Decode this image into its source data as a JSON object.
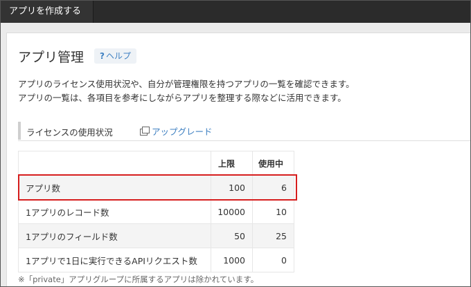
{
  "topbar": {
    "tab_label": "アプリを作成する"
  },
  "page": {
    "title": "アプリ管理",
    "help_label": "ヘルプ",
    "description_line1": "アプリのライセンス使用状況や、自分が管理権限を持つアプリの一覧を確認できます。",
    "description_line2": "アプリの一覧は、各項目を参考にしながらアプリを整理する際などに活用できます。"
  },
  "license_section": {
    "title": "ライセンスの使用状況",
    "upgrade_label": "アップグレード"
  },
  "table": {
    "headers": [
      "",
      "上限",
      "使用中"
    ],
    "rows": [
      {
        "name": "アプリ数",
        "limit": "100",
        "used": "6"
      },
      {
        "name": "1アプリのレコード数",
        "limit": "10000",
        "used": "10"
      },
      {
        "name": "1アプリのフィールド数",
        "limit": "50",
        "used": "25"
      },
      {
        "name": "1アプリで1日に実行できるAPIリクエスト数",
        "limit": "1000",
        "used": "0"
      }
    ]
  },
  "footnote": "※「private」アプリグループに所属するアプリは除かれています。",
  "colors": {
    "link": "#3d7fc1",
    "highlight_border": "#d61d1d",
    "topbar": "#2b2b2b"
  }
}
